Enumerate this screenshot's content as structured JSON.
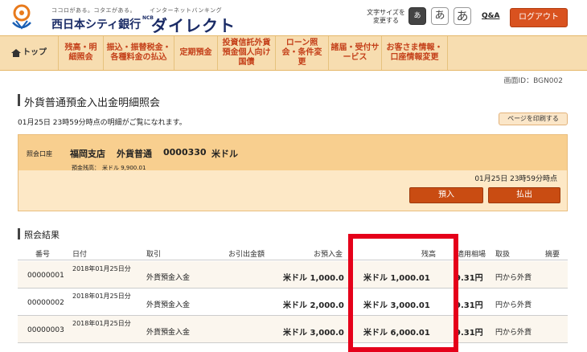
{
  "header": {
    "tagline": "ココロがある。コタエがある。",
    "bank_name": "西日本シティ銀行",
    "net_banking_small": "インターネットバンキング",
    "ncb": "NCB",
    "direct": "ダイレクト",
    "font_size_label": "文字サイズを変更する",
    "font_buttons": [
      "あ",
      "あ",
      "あ"
    ],
    "qa": "Q&A",
    "logout": "ログアウト"
  },
  "nav": {
    "items": [
      {
        "label": "トップ",
        "icon": "house-icon"
      },
      {
        "label": "残高・明細照会"
      },
      {
        "label": "振込・振替税金・各種料金の払込"
      },
      {
        "label": "定期預金"
      },
      {
        "label": "投資信託外貨預金個人向け国債"
      },
      {
        "label": "ローン照会・条件変更"
      },
      {
        "label": "諸届・受付サービス"
      },
      {
        "label": "お客さま情報・口座情報変更"
      }
    ]
  },
  "screen_id": "画面ID：BGN002",
  "page_title": "外貨普通預金入出金明細照会",
  "notice": "01月25日 23時59分時点の明細がご覧になれます。",
  "print_button": "ページを印刷する",
  "account": {
    "label": "照会口座",
    "branch": "福岡支店",
    "type": "外貨普通",
    "number": "0000330",
    "currency": "米ドル",
    "balance_label": "預金残高：",
    "balance_value": "米ドル 9,900.01",
    "as_of": "01月25日 23時59分時点",
    "deposit_button": "預入",
    "withdraw_button": "払出"
  },
  "results": {
    "title": "照会結果",
    "columns": [
      "番号",
      "日付",
      "取引",
      "お引出金額",
      "お預入金",
      "残高",
      "適用相場",
      "取扱",
      "摘要"
    ],
    "rows": [
      {
        "no": "00000001",
        "date": "2018年01月25日分",
        "txn": "外貨預金入金",
        "withdraw": "",
        "deposit": "米ドル 1,000.0",
        "balance": "米ドル 1,000.01",
        "rate": "9.31円",
        "handling": "円から外貨",
        "memo": ""
      },
      {
        "no": "00000002",
        "date": "2018年01月25日分",
        "txn": "外貨預金入金",
        "withdraw": "",
        "deposit": "米ドル 2,000.0",
        "balance": "米ドル 3,000.01",
        "rate": "9.31円",
        "handling": "円から外貨",
        "memo": ""
      },
      {
        "no": "00000003",
        "date": "2018年01月25日分",
        "txn": "外貨預金入金",
        "withdraw": "",
        "deposit": "米ドル 3,000.0",
        "balance": "米ドル 6,000.01",
        "rate": "9.31円",
        "handling": "円から外貨",
        "memo": ""
      }
    ]
  },
  "colors": {
    "accent": "#d9521f",
    "nav_bg": "#f7ddb0",
    "nav_text": "#c4401a",
    "highlight": "#e5001a"
  }
}
